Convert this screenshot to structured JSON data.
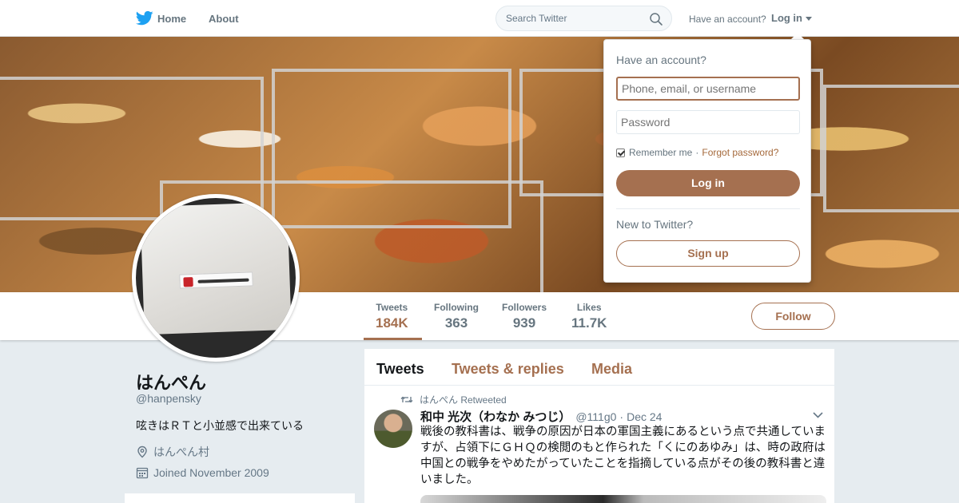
{
  "nav": {
    "home_label": "Home",
    "about_label": "About",
    "search_placeholder": "Search Twitter",
    "have_account": "Have an account?",
    "login_label": "Log in"
  },
  "login_dropdown": {
    "title": "Have an account?",
    "username_placeholder": "Phone, email, or username",
    "password_placeholder": "Password",
    "remember_me": "Remember me",
    "separator": "·",
    "forgot_password": "Forgot password?",
    "login_button": "Log in",
    "new_to_twitter": "New to Twitter?",
    "signup_button": "Sign up"
  },
  "profile_nav": {
    "stats": [
      {
        "label": "Tweets",
        "value": "184K",
        "active": true
      },
      {
        "label": "Following",
        "value": "363"
      },
      {
        "label": "Followers",
        "value": "939"
      },
      {
        "label": "Likes",
        "value": "11.7K"
      }
    ],
    "follow_button": "Follow"
  },
  "profile": {
    "name": "はんぺん",
    "handle": "@hanpensky",
    "bio": "呟きはＲＴと小並感で出来ている",
    "location": "はんぺん村",
    "joined": "Joined November 2009"
  },
  "timeline": {
    "tabs": [
      {
        "label": "Tweets",
        "active": true
      },
      {
        "label": "Tweets & replies"
      },
      {
        "label": "Media"
      }
    ],
    "tweet": {
      "retweeted_by": "はんぺん Retweeted",
      "author_name": "和中 光次（わなか みつじ）",
      "author_handle": "@111g0",
      "separator": "·",
      "time": "Dec 24",
      "text": "戦後の教科書は、戦争の原因が日本の軍国主義にあるという点で共通していますが、占領下にＧＨＱの検閲のもと作られた「くにのあゆみ」は、時の政府は中国との戦争をやめたがっていたことを指摘している点がその後の教科書と違いました。"
    }
  },
  "colors": {
    "accent": "#a57050",
    "twitter_blue": "#1da1f2",
    "background": "#e6ecf0"
  },
  "icons": [
    "twitter-bird-icon",
    "search-icon",
    "caret-down-icon",
    "location-pin-icon",
    "calendar-icon",
    "retweet-icon",
    "chevron-down-icon"
  ]
}
